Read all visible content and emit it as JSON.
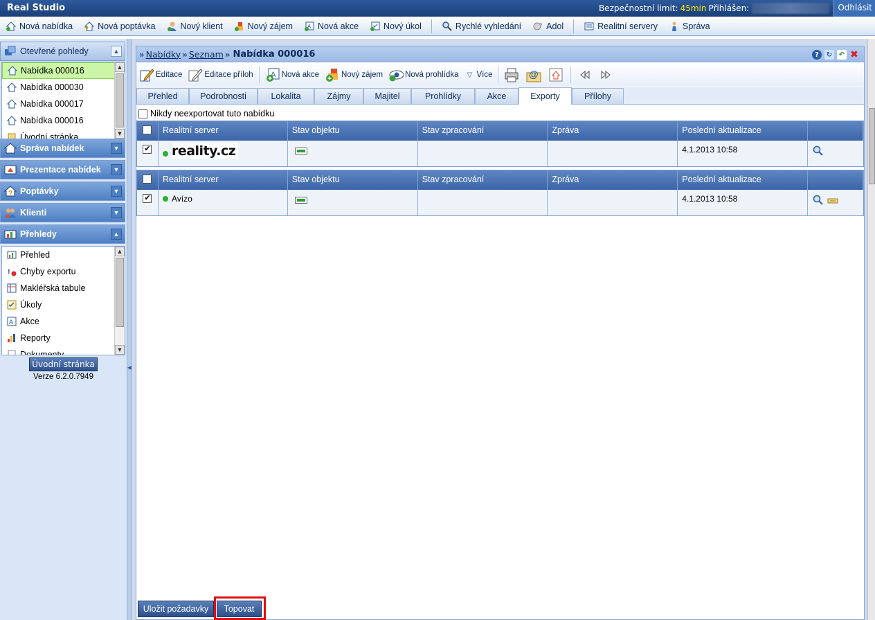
{
  "app": {
    "title": "Real Studio"
  },
  "session": {
    "security_label": "Bezpečnostní limit:",
    "security_value": "45min",
    "login_label": "Přihlášen:",
    "logout": "Odhlásit"
  },
  "menu": {
    "items": [
      {
        "label": "Nová nabídka"
      },
      {
        "label": "Nová poptávka"
      },
      {
        "label": "Nový klient"
      },
      {
        "label": "Nový zájem"
      },
      {
        "label": "Nová akce"
      },
      {
        "label": "Nový úkol"
      },
      {
        "label": "Rychlé vyhledání"
      },
      {
        "label": "Adol"
      },
      {
        "label": "Realitní servery"
      },
      {
        "label": "Správa"
      }
    ]
  },
  "left": {
    "open_views": {
      "title": "Otevřené pohledy",
      "items": [
        "Nabídka 000016",
        "Nabídka 000030",
        "Nabídka 000017",
        "Nabídka 000016",
        "Úvodní stránka"
      ]
    },
    "panels": [
      "Správa nabídek",
      "Prezentace nabídek",
      "Poptávky",
      "Klienti"
    ],
    "overviews": {
      "title": "Přehledy",
      "items": [
        "Přehled",
        "Chyby exportu",
        "Makléřská tabule",
        "Úkoly",
        "Akce",
        "Reporty",
        "Dokumenty"
      ]
    },
    "home_button": "Úvodní stránka",
    "version": "Verze 6.2.0.7949"
  },
  "breadcrumb": {
    "prefix": "»",
    "link1": "Nabídky",
    "sep": "»",
    "link2": "Seznam",
    "sep2": "»",
    "current": "Nabídka 000016"
  },
  "toolbar": {
    "edit": "Editace",
    "edit_attachments": "Editace příloh",
    "new_action": "Nová akce",
    "new_interest": "Nový zájem",
    "new_viewing": "Nová prohlídka",
    "more": "Více"
  },
  "tabs": [
    "Přehled",
    "Podrobnosti",
    "Lokalita",
    "Zájmy",
    "Majitel",
    "Prohlídky",
    "Akce",
    "Exporty",
    "Přílohy"
  ],
  "active_tab": "Exporty",
  "never_export": "Nikdy neexportovat tuto nabídku",
  "table": {
    "headers": [
      "Realitní server",
      "Stav objektu",
      "Stav zpracování",
      "Zpráva",
      "Poslední aktualizace"
    ],
    "rows": [
      {
        "server": "reality.cz",
        "checked": true,
        "updated": "4.1.2013 10:58"
      },
      {
        "server": "Avízo",
        "checked": true,
        "updated": "4.1.2013 10:58"
      }
    ]
  },
  "buttons": {
    "save": "Uložit požadavky",
    "topovat": "Topovat"
  },
  "colors": {
    "accent": "#2d5a9c",
    "highlight": "#e01010",
    "selected": "#ccf5a6",
    "status_green": "#2cb02c"
  }
}
